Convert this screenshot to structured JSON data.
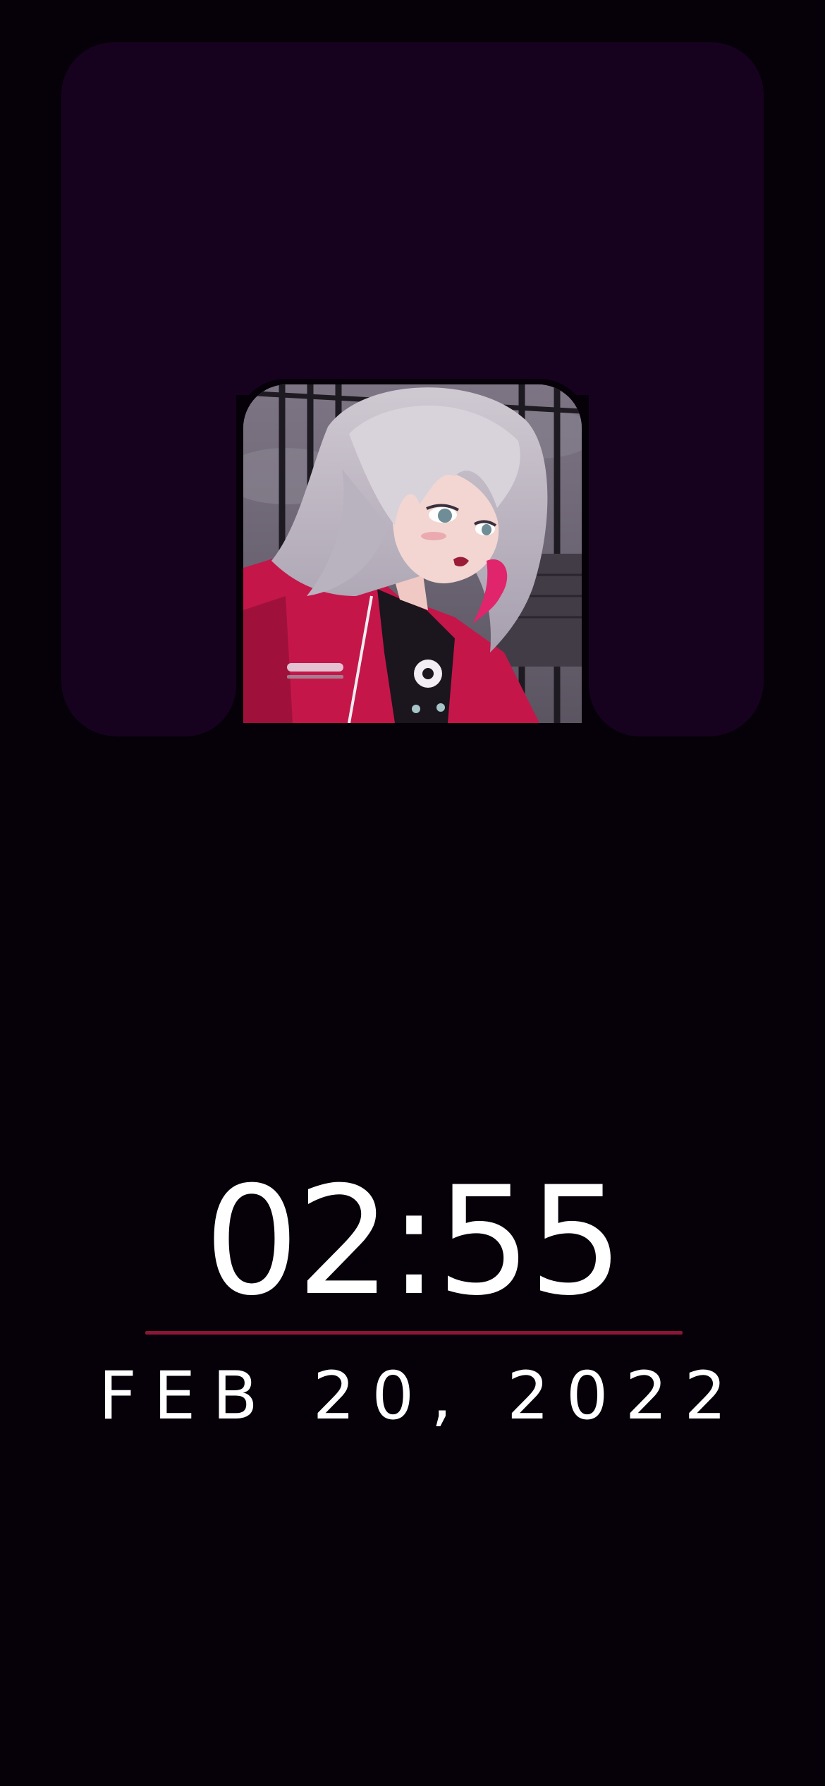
{
  "widget": {
    "image_alt": "anime girl with silver hair in a red jacket",
    "card_color": "#16021f"
  },
  "clock": {
    "time": "02:55",
    "date": "FEB 20, 2022",
    "divider_color": "#8b1638"
  },
  "background_color": "#060008"
}
